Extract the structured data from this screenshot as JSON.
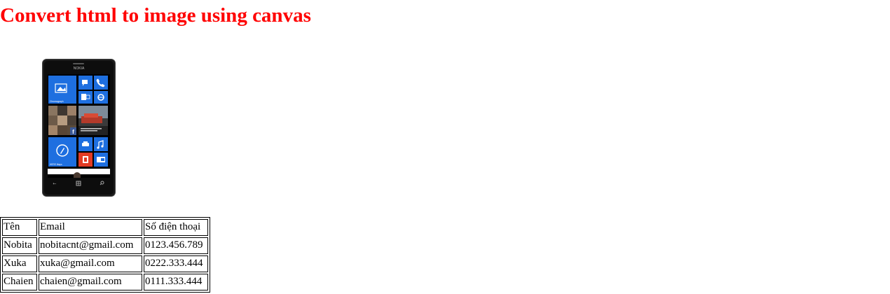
{
  "page": {
    "heading": "Convert html to image using canvas",
    "heading_color": "#ff0000"
  },
  "phone_image": {
    "brand": "NOKIA",
    "tile_caption_photos": "Chromograph",
    "tile_caption_maps": "HERE Maps",
    "tile_color": "#1e6fe0",
    "tile_office_color": "#e33b24",
    "icons": [
      "picture-tile",
      "messaging-tile",
      "phone-tile",
      "outlook-tile",
      "ie-tile",
      "people-tile",
      "news-tile",
      "compass-tile",
      "car-tile",
      "music-tile",
      "office-tile",
      "wallet-tile"
    ]
  },
  "table": {
    "headers": [
      "Tên",
      "Email",
      "Số điện thoại"
    ],
    "rows": [
      [
        "Nobita",
        "nobitacnt@gmail.com",
        "0123.456.789"
      ],
      [
        "Xuka",
        "xuka@gmail.com",
        "0222.333.444"
      ],
      [
        "Chaien",
        "chaien@gmail.com",
        "0111.333.444"
      ]
    ]
  }
}
